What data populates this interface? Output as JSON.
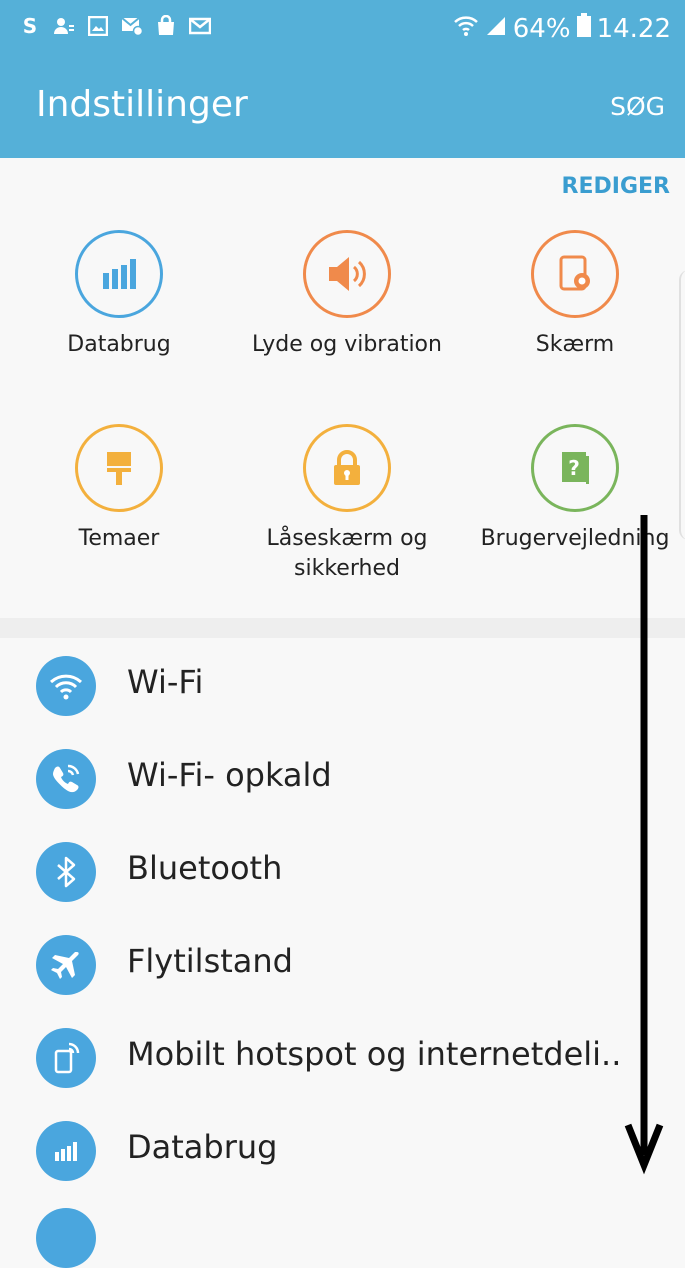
{
  "status_bar": {
    "left_icons": [
      "skype-icon",
      "contact-sync-icon",
      "gallery-icon",
      "mail-settings-icon",
      "galaxy-apps-icon",
      "email-icon"
    ],
    "skype_letter": "S",
    "battery": "64%",
    "time": "14.22"
  },
  "app_bar": {
    "title": "Indstillinger",
    "search_label": "SØG"
  },
  "quick_settings": {
    "edit_label": "REDIGER",
    "items": [
      {
        "label": "Databrug",
        "color": "#4aa6de",
        "icon": "bar-chart-icon"
      },
      {
        "label": "Lyde og vibration",
        "color": "#f08a4b",
        "icon": "speaker-icon"
      },
      {
        "label": "Skærm",
        "color": "#f08a4b",
        "icon": "display-icon"
      },
      {
        "label": "Temaer",
        "color": "#f3b03d",
        "icon": "paint-roller-icon"
      },
      {
        "label_line1": "Låseskærm og",
        "label_line2": "sikkerhed",
        "color": "#f3b03d",
        "icon": "lock-icon"
      },
      {
        "label": "Brugervejledning",
        "color": "#7ab55c",
        "icon": "help-book-icon"
      }
    ]
  },
  "settings_list": [
    {
      "label": "Wi-Fi",
      "icon": "wifi-icon"
    },
    {
      "label": "Wi-Fi- opkald",
      "icon": "wifi-calling-icon"
    },
    {
      "label": "Bluetooth",
      "icon": "bluetooth-icon"
    },
    {
      "label": "Flytilstand",
      "icon": "airplane-icon"
    },
    {
      "label": "Mobilt hotspot og internetdeli..",
      "icon": "hotspot-icon"
    },
    {
      "label": "Databrug",
      "icon": "data-usage-icon"
    }
  ],
  "colors": {
    "header": "#55b0d8",
    "accent": "#3a9dd0",
    "list_icon_bg": "#4aa6de"
  }
}
